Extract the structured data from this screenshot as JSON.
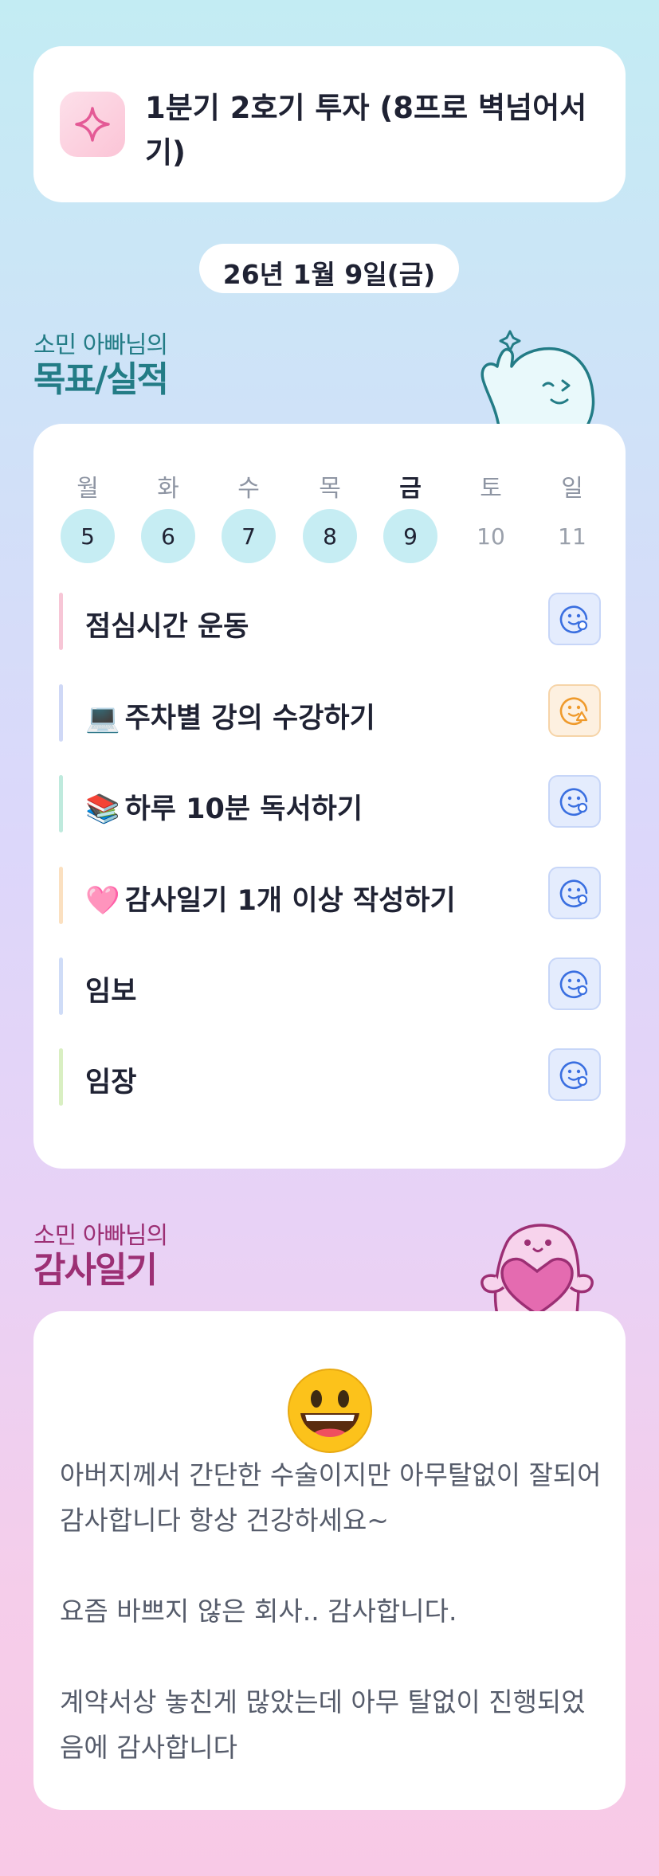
{
  "goal": {
    "icon": "sparkle-icon",
    "text": "1분기 2호기 투자 (8프로 벽넘어서기)"
  },
  "date": "26년 1월 9일(금)",
  "goals_section": {
    "subtitle": "소민 아빠님의",
    "title": "목표/실적",
    "mascot": "waving-ghost-mascot"
  },
  "week": [
    {
      "label": "월",
      "num": "5",
      "state": "done"
    },
    {
      "label": "화",
      "num": "6",
      "state": "done"
    },
    {
      "label": "수",
      "num": "7",
      "state": "done"
    },
    {
      "label": "목",
      "num": "8",
      "state": "done"
    },
    {
      "label": "금",
      "num": "9",
      "state": "today"
    },
    {
      "label": "토",
      "num": "10",
      "state": "future"
    },
    {
      "label": "일",
      "num": "11",
      "state": "future"
    }
  ],
  "goals": [
    {
      "emoji": "",
      "label": "점심시간 운동",
      "bar_color": "#f7c6d6",
      "status": "smile-check-icon",
      "status_color": "#3a6fe0"
    },
    {
      "emoji": "💻",
      "label": "주차별 강의 수강하기",
      "bar_color": "#cfd8f6",
      "status": "smile-warning-icon",
      "status_color": "#ef9a2c"
    },
    {
      "emoji": "📚",
      "label": "하루 10분 독서하기",
      "bar_color": "#bfeadd",
      "status": "smile-check-icon",
      "status_color": "#3a6fe0"
    },
    {
      "emoji": "🩷",
      "label": "감사일기 1개 이상 작성하기",
      "bar_color": "#fbe0c0",
      "status": "smile-check-icon",
      "status_color": "#3a6fe0"
    },
    {
      "emoji": "",
      "label": "임보",
      "bar_color": "#cfdcf7",
      "status": "smile-check-icon",
      "status_color": "#3a6fe0"
    },
    {
      "emoji": "",
      "label": "임장",
      "bar_color": "#d9efc2",
      "status": "smile-check-icon",
      "status_color": "#3a6fe0"
    }
  ],
  "thanks_section": {
    "subtitle": "소민 아빠님의",
    "title": "감사일기",
    "mascot": "heart-ghost-mascot"
  },
  "thanks": {
    "emoji": "😀",
    "entries": [
      "아버지께서 간단한 수술이지만 아무탈없이 잘되어 감사합니다 항상 건강하세요~",
      "요즘 바쁘지 않은 회사.. 감사합니다.",
      "계약서상 놓친게 많았는데 아무 탈없이 진행되었음에 감사합니다"
    ]
  },
  "colors": {
    "teal": "#237c86",
    "plum": "#9c2f74",
    "done_day": "#c6edf3"
  }
}
